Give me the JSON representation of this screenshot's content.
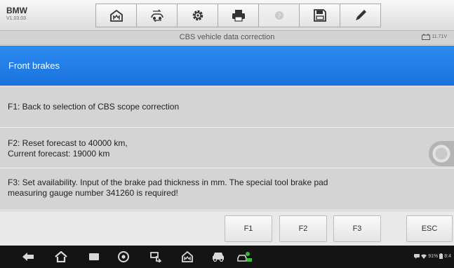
{
  "app": {
    "brand": "BMW",
    "version": "V1.03.03"
  },
  "toolbar": {
    "buttons": [
      {
        "icon": "home-icon"
      },
      {
        "icon": "vehicle-swap-icon"
      },
      {
        "icon": "settings-gear-icon"
      },
      {
        "icon": "print-icon"
      },
      {
        "icon": "help-icon",
        "disabled": true
      },
      {
        "icon": "save-icon"
      },
      {
        "icon": "pen-icon"
      }
    ]
  },
  "titlebar": {
    "title": "CBS vehicle data correction",
    "battery_voltage": "11.71V"
  },
  "header": {
    "text": "Front brakes"
  },
  "rows": [
    {
      "lines": [
        "F1: Back to selection of CBS scope correction"
      ]
    },
    {
      "lines": [
        "F2: Reset forecast to 40000 km,",
        "Current forecast: 19000 km"
      ]
    },
    {
      "lines": [
        "F3: Set availability. Input of the brake pad thickness in mm. The special tool brake pad",
        "measuring gauge number 341260 is required!"
      ]
    }
  ],
  "function_keys": {
    "f1": "F1",
    "f2": "F2",
    "f3": "F3",
    "esc": "ESC"
  },
  "status_bar": {
    "battery": "91%",
    "clock": "8:4"
  },
  "colors": {
    "header_blue": "#1f7ee8",
    "row_gray": "#d4d4d4",
    "nav_black": "#141414"
  }
}
